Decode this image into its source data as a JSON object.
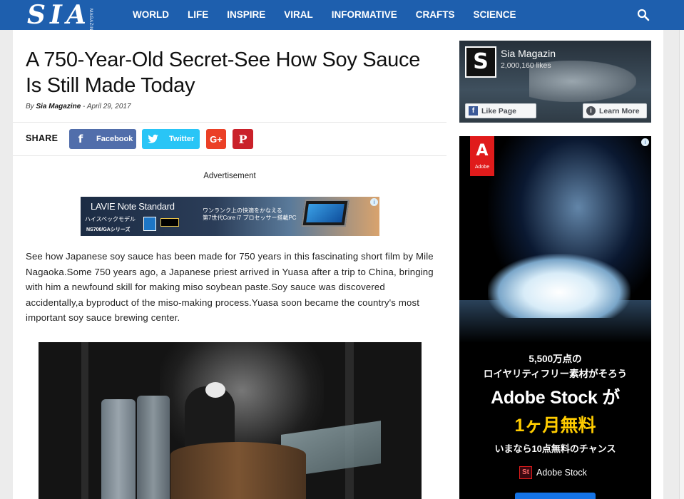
{
  "header": {
    "logo_text": "SIA",
    "logo_sub": "MAGAZINE",
    "nav": [
      "WORLD",
      "LIFE",
      "INSPIRE",
      "VIRAL",
      "INFORMATIVE",
      "CRAFTS",
      "SCIENCE"
    ],
    "search_icon": "search-icon",
    "brand_color": "#1e5fae"
  },
  "article": {
    "title": "A 750-Year-Old Secret-See How Soy Sauce Is Still Made Today",
    "by_prefix": "By",
    "author": "Sia Magazine",
    "date_sep": "-",
    "date": "April 29, 2017",
    "share_label": "SHARE",
    "share": {
      "facebook": "Facebook",
      "twitter": "Twitter",
      "googleplus": "G+",
      "pinterest": "P"
    },
    "ad_label": "Advertisement",
    "banner_ad": {
      "brand": "LAVIE Note Standard",
      "line1": "ハイスペックモデル",
      "model": "NS700/GAシリーズ",
      "copy1": "ワンランク上の快適をかなえる",
      "copy2": "第7世代Core i7 プロセッサー搭載PC",
      "info": "i"
    },
    "body": "See how Japanese soy sauce has been made for 750 years in this fascinating short film by Mile Nagaoka.Some 750 years ago, a Japanese priest arrived in Yuasa after a trip to China, bringing with him a newfound skill for making miso soybean paste.Soy sauce was discovered accidentally,a byproduct of the miso-making process.Yuasa soon became the country's most important soy sauce brewing center."
  },
  "sidebar": {
    "fb_widget": {
      "logo": "S",
      "page_name": "Sia Magazin",
      "likes": "2,000,160 likes",
      "like_button": "Like Page",
      "learn_button": "Learn More"
    },
    "adobe_ad": {
      "logo_text": "Adobe",
      "line1": "5,500万点の",
      "line2": "ロイヤリティフリー素材がそろう",
      "headline": "Adobe Stock が",
      "offer": "1ヶ月無料",
      "line3": "いまなら10点無料のチャンス",
      "product_badge": "St",
      "product": "Adobe Stock",
      "info": "i"
    }
  }
}
